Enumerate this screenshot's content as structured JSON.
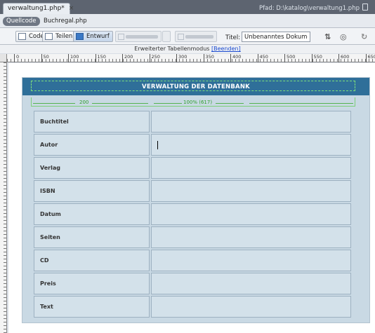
{
  "document_tab": {
    "filename": "verwaltung1.php*",
    "close": "×"
  },
  "path_label": "Pfad: D:\\katalog\\verwaltung1.php",
  "related_files": {
    "source": "Quellcode",
    "file": "Buchregal.php"
  },
  "toolbar": {
    "code_label": "Code",
    "split_label": "Teilen",
    "design_label": "Entwurf",
    "title_label": "Titel:",
    "title_value": "Unbenanntes Dokument",
    "browse_icon": "file-management-icon",
    "preview_icon": "preview-browser-icon"
  },
  "mode_bar": {
    "text": "Erweiterter Tabellenmodus",
    "exit_link": "[Beenden]"
  },
  "ruler": {
    "ticks": [
      "0",
      "50",
      "100",
      "150",
      "200",
      "250",
      "300",
      "350",
      "400",
      "450",
      "500",
      "550",
      "600",
      "650"
    ]
  },
  "design": {
    "header_title": "VERWALTUNG DER DATENBANK",
    "width_total": "100% (617)",
    "width_column": "200",
    "rows": [
      "Buchtitel",
      "Autor",
      "Verlag",
      "ISBN",
      "Datum",
      "Seiten",
      "CD",
      "Preis",
      "Text"
    ]
  },
  "colors": {
    "header_band": "#2f6f99",
    "cell_fill": "#d3e1ea",
    "width_indicator": "#52b34f"
  }
}
